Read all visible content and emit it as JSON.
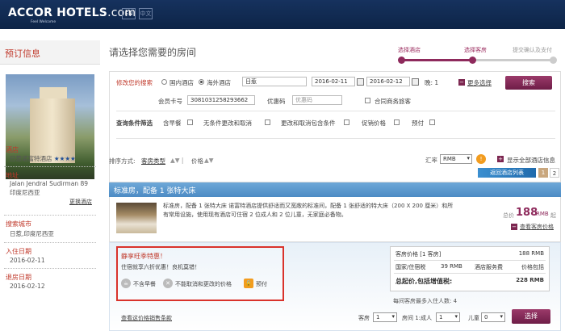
{
  "header": {
    "logo_main": "ACCOR HOTELS",
    "logo_suffix": ".com",
    "tagline": "Feel Welcome",
    "lang_en": "EN",
    "lang_zh": "中文"
  },
  "sidebar": {
    "title": "预订信息",
    "hotel_label": "酒店",
    "hotel_name": "日惹诺富特酒店",
    "hotel_stars": "★★★★",
    "address_label": "地址",
    "address_line1": "Jalan Jendral Sudirman 89",
    "address_line2": "印度尼西亚",
    "change_hotel": "更换酒店",
    "city_label": "搜索城市",
    "city_value": "日惹,印度尼西亚",
    "checkin_label": "入住日期",
    "checkin_value": "2016-02-11",
    "checkout_label": "退房日期",
    "checkout_value": "2016-02-12"
  },
  "main": {
    "title": "请选择您需要的房间"
  },
  "steps": [
    {
      "label": "选择酒店"
    },
    {
      "label": "选择客房"
    },
    {
      "label": "提交确认及支付"
    }
  ],
  "search": {
    "modify_label": "修改您的搜索",
    "domestic": "国内酒店",
    "overseas": "海外酒店",
    "destination": "日惹",
    "checkin": "2016-02-11",
    "checkout": "2016-02-12",
    "nights_label": "晚:",
    "nights": "1",
    "more_options": "更多选择",
    "search_button": "搜索",
    "member_label": "会员卡号",
    "member_value": "3081031258293662",
    "promo_label": "优惠码",
    "promo_placeholder": "优惠码",
    "corporate": "合同商务旅客",
    "filter_label": "查询条件筛选",
    "filters": [
      "含早餐",
      "无条件更改和取消",
      "更改和取消包含条件",
      "促销价格",
      "预付"
    ]
  },
  "sort": {
    "label": "排序方式:",
    "room_type": "客房类型",
    "price": "价格",
    "currency_label": "汇率",
    "currency": "RMB",
    "show_all": "显示全部酒店信息",
    "back_to_list": "返回酒店列表",
    "pages": [
      "1",
      "2"
    ]
  },
  "room": {
    "title": "标准房，配备 1 张特大床",
    "description": "标准房，配备 1 张特大床 诺富特酒店提供舒适而又宽敞的标准间，配备 1 张舒适的特大床（200 X 200 厘米）和所有常用设施，使用现有酒店可住宿 2 位成人和 2 位儿童，无家庭必备物。",
    "from_label": "总价",
    "price": "188",
    "currency": "RMB",
    "from_suffix": "起",
    "view_rooms": "查看客房价格"
  },
  "offer": {
    "promo_title": "静享旺季特惠！",
    "promo_sub": "住宿就享六折优惠！良机莫错！",
    "tag_no_breakfast": "不含早餐",
    "tag_no_cancel": "不能取消和更改的价格",
    "tag_prepay": "预付",
    "room_price_label": "客房价格 [1 客房]",
    "room_price_value": "188 RMB",
    "tax_label": "国家/住宿税",
    "tax_value": "39 RMB",
    "service_label": "酒店服务费",
    "service_value": "价格包括",
    "total_label": "总起价,包括增值税:",
    "total_value": "228 RMB",
    "max_persons": "每间客房最多入住人数: 4",
    "terms_link": "查看这价格销售条款",
    "rooms_label": "客房",
    "rooms_value": "1",
    "room1_label": "房间 1:成人",
    "adults_value": "1",
    "children_label": "儿童",
    "children_value": "0",
    "select_button": "选择"
  }
}
